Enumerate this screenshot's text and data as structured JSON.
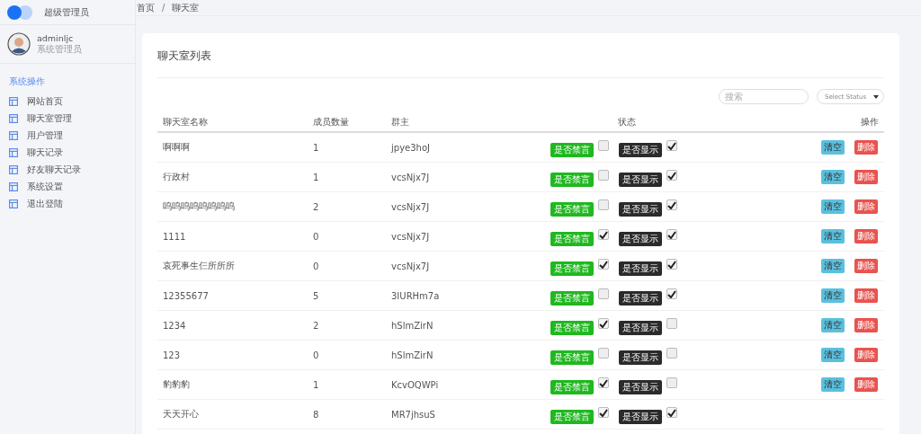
{
  "brand": {
    "title": "超级管理员"
  },
  "user": {
    "name": "adminljc",
    "role": "系统管理员"
  },
  "sidebar": {
    "section": "系统操作",
    "items": [
      {
        "label": "网站首页"
      },
      {
        "label": "聊天室管理"
      },
      {
        "label": "用户管理"
      },
      {
        "label": "聊天记录"
      },
      {
        "label": "好友聊天记录"
      },
      {
        "label": "系统设置"
      },
      {
        "label": "退出登陆"
      }
    ]
  },
  "breadcrumb": [
    "首页",
    "/",
    "聊天室"
  ],
  "card": {
    "title": "聊天室列表"
  },
  "search": {
    "placeholder": "搜索"
  },
  "status_select": {
    "value": "Select Status"
  },
  "table": {
    "columns": [
      "聊天室名称",
      "成员数量",
      "群主",
      "状态",
      "操作"
    ],
    "rows": [
      {
        "name": "啊啊啊",
        "members": "1",
        "owner": "jpye3hoJ",
        "mute_label": "是否禁言",
        "muted": false,
        "show_label": "是否显示",
        "shown": true,
        "actions": [
          "清空",
          "删除"
        ]
      },
      {
        "name": "行政村",
        "members": "1",
        "owner": "vcsNjx7J",
        "mute_label": "是否禁言",
        "muted": false,
        "show_label": "是否显示",
        "shown": true,
        "actions": [
          "清空",
          "删除"
        ]
      },
      {
        "name": "呜呜呜呜呜呜呜呜",
        "members": "2",
        "owner": "vcsNjx7J",
        "mute_label": "是否禁言",
        "muted": false,
        "show_label": "是否显示",
        "shown": true,
        "actions": [
          "清空",
          "删除"
        ]
      },
      {
        "name": "1111",
        "members": "0",
        "owner": "vcsNjx7J",
        "mute_label": "是否禁言",
        "muted": true,
        "show_label": "是否显示",
        "shown": true,
        "actions": [
          "清空",
          "删除"
        ]
      },
      {
        "name": "哀死事生仨所所所",
        "members": "0",
        "owner": "vcsNjx7J",
        "mute_label": "是否禁言",
        "muted": true,
        "show_label": "是否显示",
        "shown": true,
        "actions": [
          "清空",
          "删除"
        ]
      },
      {
        "name": "12355677",
        "members": "5",
        "owner": "3IURHm7a",
        "mute_label": "是否禁言",
        "muted": false,
        "show_label": "是否显示",
        "shown": true,
        "actions": [
          "清空",
          "删除"
        ]
      },
      {
        "name": "1234",
        "members": "2",
        "owner": "hSlmZirN",
        "mute_label": "是否禁言",
        "muted": true,
        "show_label": "是否显示",
        "shown": false,
        "actions": [
          "清空",
          "删除"
        ]
      },
      {
        "name": "123",
        "members": "0",
        "owner": "hSlmZirN",
        "mute_label": "是否禁言",
        "muted": false,
        "show_label": "是否显示",
        "shown": false,
        "actions": [
          "清空",
          "删除"
        ]
      },
      {
        "name": "豹豹豹",
        "members": "1",
        "owner": "KcvOQWPi",
        "mute_label": "是否禁言",
        "muted": true,
        "show_label": "是否显示",
        "shown": false,
        "actions": [
          "清空",
          "删除"
        ]
      },
      {
        "name": "天天开心",
        "members": "8",
        "owner": "MR7jhsuS",
        "mute_label": "是否禁言",
        "muted": true,
        "show_label": "是否显示",
        "shown": true
      }
    ]
  }
}
